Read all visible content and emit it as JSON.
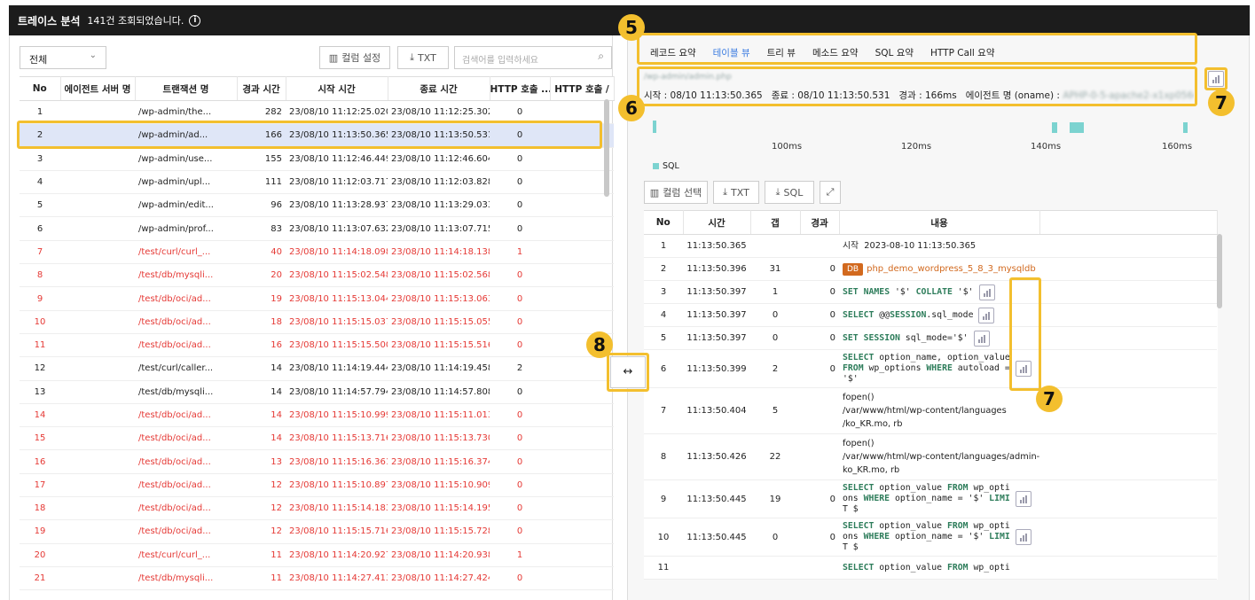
{
  "header": {
    "title": "트레이스 분석",
    "count_text": "141건 조회되었습니다.",
    "info_icon": "i"
  },
  "left_toolbar": {
    "filter_value": "전체",
    "column_settings": "컬럼 설정",
    "txt_label": "TXT",
    "search_placeholder": "검색어를 입력하세요"
  },
  "left_table": {
    "headers": [
      "No",
      "에이전트 서버 명",
      "트랜잭션 명",
      "경과 시간",
      "시작 시간",
      "종료 시간",
      "HTTP 호출 ...",
      "HTTP 호출 /"
    ],
    "rows": [
      {
        "no": "1",
        "tx": "/wp-admin/the...",
        "el": "282",
        "st": "23/08/10 11:12:25.020",
        "et": "23/08/10 11:12:25.302",
        "http": "0",
        "err": false
      },
      {
        "no": "2",
        "tx": "/wp-admin/ad...",
        "el": "166",
        "st": "23/08/10 11:13:50.365",
        "et": "23/08/10 11:13:50.531",
        "http": "0",
        "err": false,
        "selected": true
      },
      {
        "no": "3",
        "tx": "/wp-admin/use...",
        "el": "155",
        "st": "23/08/10 11:12:46.449",
        "et": "23/08/10 11:12:46.604",
        "http": "0",
        "err": false
      },
      {
        "no": "4",
        "tx": "/wp-admin/upl...",
        "el": "111",
        "st": "23/08/10 11:12:03.717",
        "et": "23/08/10 11:12:03.828",
        "http": "0",
        "err": false
      },
      {
        "no": "5",
        "tx": "/wp-admin/edit...",
        "el": "96",
        "st": "23/08/10 11:13:28.937",
        "et": "23/08/10 11:13:29.033",
        "http": "0",
        "err": false
      },
      {
        "no": "6",
        "tx": "/wp-admin/prof...",
        "el": "83",
        "st": "23/08/10 11:13:07.632",
        "et": "23/08/10 11:13:07.715",
        "http": "0",
        "err": false
      },
      {
        "no": "7",
        "tx": "/test/curl/curl_...",
        "el": "40",
        "st": "23/08/10 11:14:18.098",
        "et": "23/08/10 11:14:18.138",
        "http": "1",
        "err": true
      },
      {
        "no": "8",
        "tx": "/test/db/mysqli...",
        "el": "20",
        "st": "23/08/10 11:15:02.548",
        "et": "23/08/10 11:15:02.568",
        "http": "0",
        "err": true
      },
      {
        "no": "9",
        "tx": "/test/db/oci/ad...",
        "el": "19",
        "st": "23/08/10 11:15:13.044",
        "et": "23/08/10 11:15:13.063",
        "http": "0",
        "err": true
      },
      {
        "no": "10",
        "tx": "/test/db/oci/ad...",
        "el": "18",
        "st": "23/08/10 11:15:15.037",
        "et": "23/08/10 11:15:15.055",
        "http": "0",
        "err": true
      },
      {
        "no": "11",
        "tx": "/test/db/oci/ad...",
        "el": "16",
        "st": "23/08/10 11:15:15.500",
        "et": "23/08/10 11:15:15.516",
        "http": "0",
        "err": true
      },
      {
        "no": "12",
        "tx": "/test/curl/caller...",
        "el": "14",
        "st": "23/08/10 11:14:19.444",
        "et": "23/08/10 11:14:19.458",
        "http": "2",
        "err": false
      },
      {
        "no": "13",
        "tx": "/test/db/mysqli...",
        "el": "14",
        "st": "23/08/10 11:14:57.794",
        "et": "23/08/10 11:14:57.808",
        "http": "0",
        "err": false
      },
      {
        "no": "14",
        "tx": "/test/db/oci/ad...",
        "el": "14",
        "st": "23/08/10 11:15:10.999",
        "et": "23/08/10 11:15:11.013",
        "http": "0",
        "err": true
      },
      {
        "no": "15",
        "tx": "/test/db/oci/ad...",
        "el": "14",
        "st": "23/08/10 11:15:13.716",
        "et": "23/08/10 11:15:13.730",
        "http": "0",
        "err": true
      },
      {
        "no": "16",
        "tx": "/test/db/oci/ad...",
        "el": "13",
        "st": "23/08/10 11:15:16.361",
        "et": "23/08/10 11:15:16.374",
        "http": "0",
        "err": true
      },
      {
        "no": "17",
        "tx": "/test/db/oci/ad...",
        "el": "12",
        "st": "23/08/10 11:15:10.897",
        "et": "23/08/10 11:15:10.909",
        "http": "0",
        "err": true
      },
      {
        "no": "18",
        "tx": "/test/db/oci/ad...",
        "el": "12",
        "st": "23/08/10 11:15:14.183",
        "et": "23/08/10 11:15:14.195",
        "http": "0",
        "err": true
      },
      {
        "no": "19",
        "tx": "/test/db/oci/ad...",
        "el": "12",
        "st": "23/08/10 11:15:15.716",
        "et": "23/08/10 11:15:15.728",
        "http": "0",
        "err": true
      },
      {
        "no": "20",
        "tx": "/test/curl/curl_...",
        "el": "11",
        "st": "23/08/10 11:14:20.927",
        "et": "23/08/10 11:14:20.938",
        "http": "1",
        "err": true
      },
      {
        "no": "21",
        "tx": "/test/db/mysqli...",
        "el": "11",
        "st": "23/08/10 11:14:27.413",
        "et": "23/08/10 11:14:27.424",
        "http": "0",
        "err": true
      }
    ]
  },
  "tabs": [
    "레코드 요약",
    "테이블 뷰",
    "트리 뷰",
    "메소드 요약",
    "SQL 요약",
    "HTTP Call 요약"
  ],
  "active_tab": 1,
  "trace": {
    "url": "/wp-admin/admin.php",
    "start_label": "시작 :",
    "start": "08/10 11:13:50.365",
    "end_label": "종료 :",
    "end": "08/10 11:13:50.531",
    "elapsed_label": "경과 :",
    "elapsed": "166ms",
    "agent_label": "에이전트 명 (oname) :",
    "agent": "APHP-0-5-apache2-x1xp0564-w8vfw"
  },
  "timeline": {
    "ticks": [
      "100ms",
      "120ms",
      "140ms",
      "160ms"
    ],
    "legend": "SQL",
    "color": "#7cd3d0"
  },
  "right_toolbar": {
    "column_select": "컬럼 선택",
    "txt": "TXT",
    "sql": "SQL"
  },
  "right_table": {
    "headers": [
      "No",
      "시간",
      "갭",
      "경과",
      "내용"
    ],
    "rows": [
      {
        "no": "1",
        "time": "11:13:50.365",
        "gap": "",
        "el": "",
        "kind": "text",
        "content": "시작  2023-08-10 11:13:50.365"
      },
      {
        "no": "2",
        "time": "11:13:50.396",
        "gap": "31",
        "el": "0",
        "kind": "db",
        "badge": "DB",
        "content": "php_demo_wordpress_5_8_3_mysqldb"
      },
      {
        "no": "3",
        "time": "11:13:50.397",
        "gap": "1",
        "el": "0",
        "kind": "sql",
        "content": "SET NAMES '$' COLLATE '$'"
      },
      {
        "no": "4",
        "time": "11:13:50.397",
        "gap": "0",
        "el": "0",
        "kind": "sql",
        "content": "SELECT @@SESSION.sql_mode"
      },
      {
        "no": "5",
        "time": "11:13:50.397",
        "gap": "0",
        "el": "0",
        "kind": "sql",
        "content": "SET SESSION sql_mode='$'"
      },
      {
        "no": "6",
        "time": "11:13:50.399",
        "gap": "2",
        "el": "0",
        "kind": "sql",
        "content": "SELECT option_name, option_value\nFROM wp_options WHERE autoload =\n'$'"
      },
      {
        "no": "7",
        "time": "11:13:50.404",
        "gap": "5",
        "el": "",
        "kind": "text",
        "content": "fopen()\n/var/www/html/wp-content/languages\n/ko_KR.mo, rb"
      },
      {
        "no": "8",
        "time": "11:13:50.426",
        "gap": "22",
        "el": "",
        "kind": "text",
        "content": "fopen()\n/var/www/html/wp-content/languages/admin-\nko_KR.mo, rb"
      },
      {
        "no": "9",
        "time": "11:13:50.445",
        "gap": "19",
        "el": "0",
        "kind": "sql",
        "content": "SELECT option_value FROM wp_opti\nons WHERE option_name = '$' LIMI\nT $"
      },
      {
        "no": "10",
        "time": "11:13:50.445",
        "gap": "0",
        "el": "0",
        "kind": "sql",
        "content": "SELECT option_value FROM wp_opti\nons WHERE option_name = '$' LIMI\nT $"
      },
      {
        "no": "11",
        "time": "",
        "gap": "",
        "el": "",
        "kind": "sql",
        "content": "SELECT option_value FROM wp_opti"
      }
    ]
  },
  "callouts": [
    "5",
    "6",
    "7",
    "7",
    "8"
  ],
  "highlight_color": "#f3bf2e"
}
